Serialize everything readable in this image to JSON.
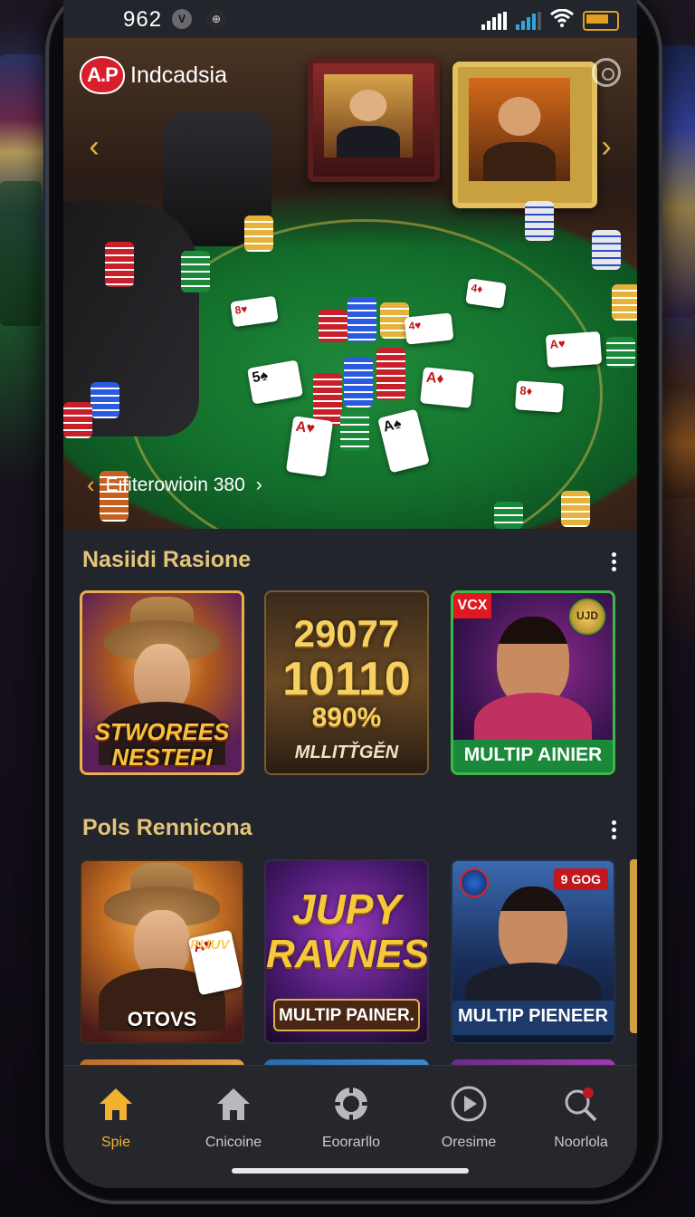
{
  "status_bar": {
    "time": "962",
    "badge1": "V",
    "badge2": "⊕"
  },
  "brand": {
    "logo": "A.P",
    "name": "Indcadsia"
  },
  "hero": {
    "caption": "Eifiterowioin 380",
    "prev": "‹",
    "next": "›",
    "caption_arrow": "›"
  },
  "sections": [
    {
      "title": "Nasiidi Rasione",
      "tiles": [
        {
          "line1": "STWOREES",
          "line2": "NESTEPI"
        },
        {
          "line1": "29077",
          "line2": "10110",
          "line3": "890%",
          "label": "MLLITŤGĚN"
        },
        {
          "corner_badge": "VCX",
          "coin_badge": "UJD",
          "label": "MULTIP AINIER"
        }
      ]
    },
    {
      "title": "Pols Rennicona",
      "tiles": [
        {
          "overlay": "PIJUV",
          "label": "OTOVS"
        },
        {
          "line1": "JUPY",
          "line2": "RAVNES",
          "label": "MULTIP PAINER."
        },
        {
          "corner_badge": "9 GOG",
          "label": "MULTIP PIENEER"
        }
      ]
    }
  ],
  "nav": [
    {
      "label": "Spie",
      "icon": "home-icon",
      "active": true
    },
    {
      "label": "Cnicoine",
      "icon": "house-outline-icon",
      "active": false
    },
    {
      "label": "Eoorarllo",
      "icon": "chip-icon",
      "active": false
    },
    {
      "label": "Oresime",
      "icon": "play-circle-icon",
      "active": false
    },
    {
      "label": "Noorlola",
      "icon": "search-icon",
      "active": false
    }
  ],
  "colors": {
    "accent": "#f2b230",
    "section_title": "#e2c47a",
    "background": "#23252c"
  }
}
